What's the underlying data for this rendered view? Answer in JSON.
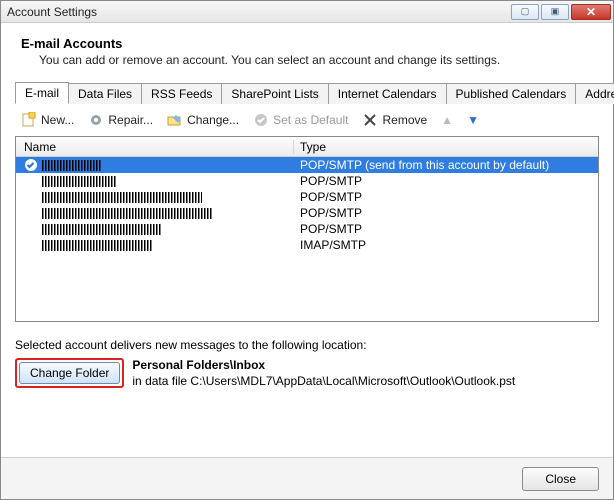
{
  "window": {
    "title": "Account Settings"
  },
  "win_buttons": {
    "min": "▢",
    "max": "▣",
    "close": "✕"
  },
  "header": {
    "title": "E-mail Accounts",
    "sub": "You can add or remove an account. You can select an account and change its settings."
  },
  "tabs": [
    {
      "label": "E-mail",
      "active": true
    },
    {
      "label": "Data Files"
    },
    {
      "label": "RSS Feeds"
    },
    {
      "label": "SharePoint Lists"
    },
    {
      "label": "Internet Calendars"
    },
    {
      "label": "Published Calendars"
    },
    {
      "label": "Address Books"
    }
  ],
  "toolbar": {
    "new": "New...",
    "repair": "Repair...",
    "change": "Change...",
    "set_default": "Set as Default",
    "remove": "Remove"
  },
  "columns": {
    "name": "Name",
    "type": "Type"
  },
  "accounts": [
    {
      "type": "POP/SMTP (send from this account by default)",
      "selected": true,
      "default": true,
      "redact_w": 60
    },
    {
      "type": "POP/SMTP",
      "redact_w": 75
    },
    {
      "type": "POP/SMTP",
      "redact_w": 160
    },
    {
      "type": "POP/SMTP",
      "redact_w": 170
    },
    {
      "type": "POP/SMTP",
      "redact_w": 120
    },
    {
      "type": "IMAP/SMTP",
      "redact_w": 110
    }
  ],
  "delivery": {
    "label": "Selected account delivers new messages to the following location:",
    "button": "Change Folder",
    "loc1": "Personal Folders\\Inbox",
    "loc2": "in data file C:\\Users\\MDL7\\AppData\\Local\\Microsoft\\Outlook\\Outlook.pst"
  },
  "footer": {
    "close": "Close"
  }
}
